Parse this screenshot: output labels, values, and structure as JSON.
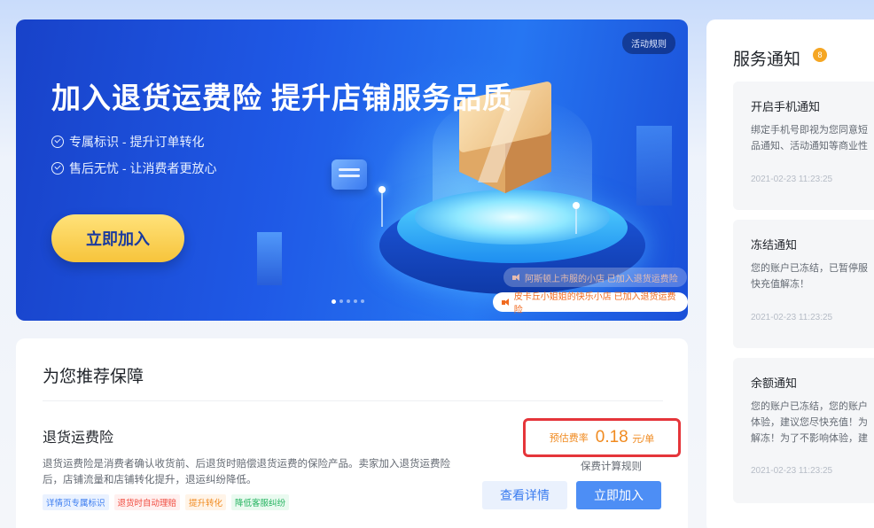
{
  "banner": {
    "title": "加入退货运费险 提升店铺服务品质",
    "features": [
      "专属标识 - 提升订单转化",
      "售后无忧 - 让消费者更放心"
    ],
    "join_label": "立即加入",
    "rules_label": "活动规则",
    "tickers": [
      "阿斯顿上市服的小店 已加入退货运费险",
      "皮卡丘小姐姐的快乐小店 已加入退货运费险"
    ],
    "carousel_dots": 5
  },
  "recommend": {
    "title": "为您推荐保障",
    "insurance": {
      "name": "退货运费险",
      "description": "退货运费险是消费者确认收货前、后退货时赔偿退货运费的保险产品。卖家加入退货运费险后，店铺流量和店铺转化提升，退运纠纷降低。",
      "tags": [
        "详情页专属标识",
        "退货时自动理赔",
        "提升转化",
        "降低客服纠纷"
      ],
      "rate_label": "预估费率",
      "rate_value": "0.18",
      "rate_unit": "元/单",
      "calc_link": "保费计算规则",
      "detail_button": "查看详情",
      "join_button": "立即加入"
    }
  },
  "service": {
    "title": "服务通知",
    "badge": "8",
    "notices": [
      {
        "title": "开启手机通知",
        "body": "绑定手机号即视为您同意短\n品通知、活动通知等商业性",
        "time": "2021-02-23 11:23:25"
      },
      {
        "title": "冻结通知",
        "body": "您的账户已冻结，已暂停服\n快充值解冻！",
        "time": "2021-02-23 11:23:25"
      },
      {
        "title": "余额通知",
        "body": "您的账户已冻结，您的账户\n体验，建议您尽快充值！为\n解冻！为了不影响体验，建",
        "time": "2021-02-23 11:23:25"
      }
    ]
  }
}
